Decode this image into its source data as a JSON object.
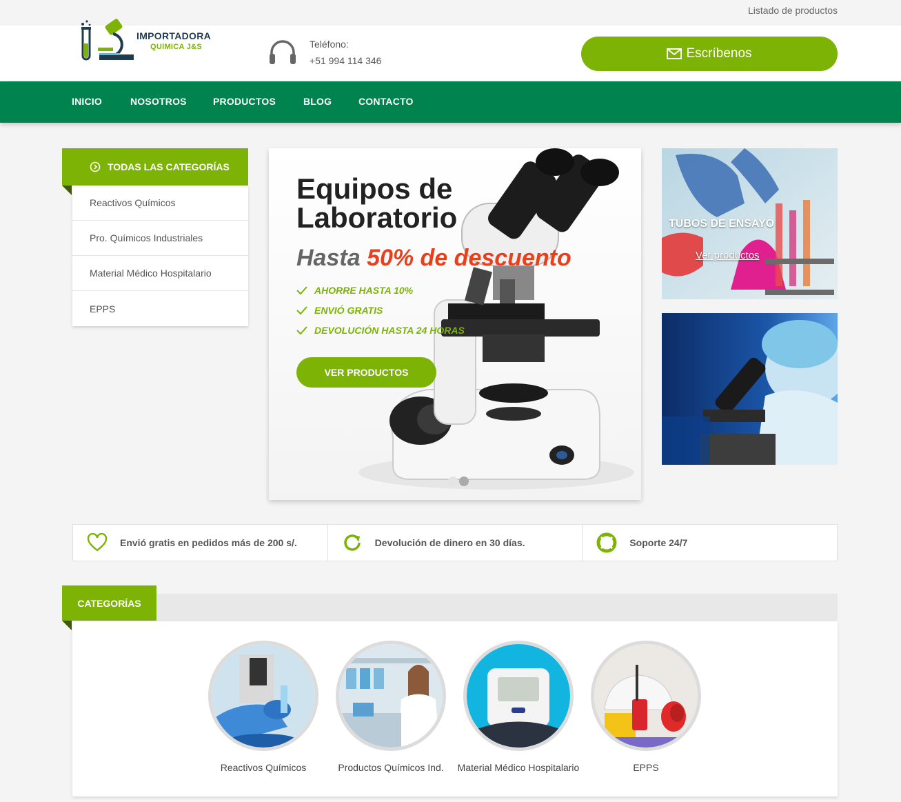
{
  "topbar": {
    "link": "Listado de productos"
  },
  "header": {
    "logo_title": "IMPORTADORA",
    "logo_subtitle": "QUIMICA J&S",
    "phone_label": "Teléfono:",
    "phone_number": "+51 994 114 346",
    "cta_label": "Escríbenos",
    "cta_icon": "envelope-icon"
  },
  "nav": {
    "items": [
      {
        "label": "INICIO"
      },
      {
        "label": "NOSOTROS"
      },
      {
        "label": "PRODUCTOS"
      },
      {
        "label": "BLOG"
      },
      {
        "label": "CONTACTO"
      }
    ]
  },
  "sidebar": {
    "title": "TODAS LAS CATEGORÍAS",
    "items": [
      {
        "label": "Reactivos Químicos"
      },
      {
        "label": "Pro. Químicos Industriales"
      },
      {
        "label": "Material Médico Hospitalario"
      },
      {
        "label": "EPPS"
      }
    ]
  },
  "hero": {
    "title": "Equipos de Laboratorio",
    "subtitle_prefix": "Hasta",
    "subtitle_highlight": "50% de descuento",
    "features": [
      {
        "label": "AHORRE HASTA 10%"
      },
      {
        "label": "ENVIÓ GRATIS"
      },
      {
        "label": "DEVOLUCIÓN HASTA 24 HORAS"
      }
    ],
    "button": "VER PRODUCTOS",
    "slides_total": 2,
    "slide_active": 2
  },
  "promos": [
    {
      "title": "TUBOS DE ENSAYO",
      "link": "Ver productos"
    },
    {
      "title": "",
      "link": ""
    }
  ],
  "features": [
    {
      "icon": "heart-icon",
      "label": "Envió gratis en pedidos más de 200 s/."
    },
    {
      "icon": "refresh-icon",
      "label": "Devolución de dinero en 30 días."
    },
    {
      "icon": "lifebuoy-icon",
      "label": "Soporte 24/7"
    }
  ],
  "categories": {
    "title": "CATEGORÍAS",
    "items": [
      {
        "label": "Reactivos Químicos"
      },
      {
        "label": "Productos Químicos Ind."
      },
      {
        "label": "Material Médico Hospitalario"
      },
      {
        "label": "EPPS"
      }
    ]
  },
  "colors": {
    "brand_green": "#7cb305",
    "nav_green": "#00834e",
    "accent_red": "#e8401c"
  }
}
